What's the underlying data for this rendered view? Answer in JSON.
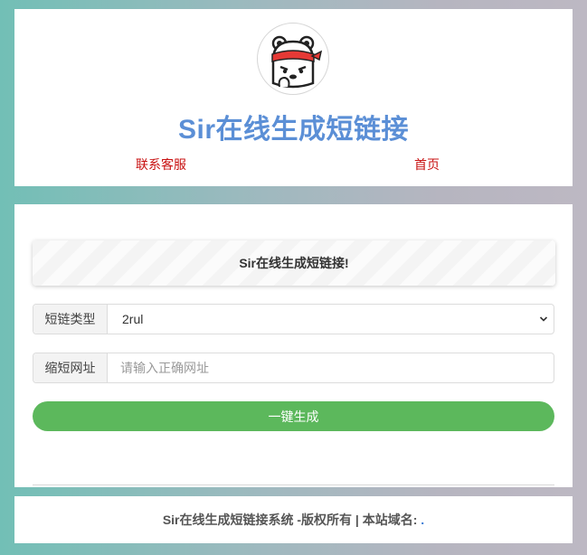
{
  "header": {
    "title": "Sir在线生成短链接",
    "nav": [
      {
        "label": "联系客服"
      },
      {
        "label": "首页"
      }
    ]
  },
  "main": {
    "notice": "Sir在线生成短链接!",
    "type_field": {
      "label": "短链类型",
      "value": "2rul"
    },
    "url_field": {
      "label": "缩短网址",
      "value": "",
      "placeholder": "请输入正确网址"
    },
    "generate_button": "一键生成"
  },
  "footer": {
    "text": "Sir在线生成短链接系统 -版权所有 | 本站域名:",
    "domain": "."
  },
  "colors": {
    "title": "#5b8fd6",
    "nav_link": "#c81010",
    "button": "#5cb85c"
  }
}
